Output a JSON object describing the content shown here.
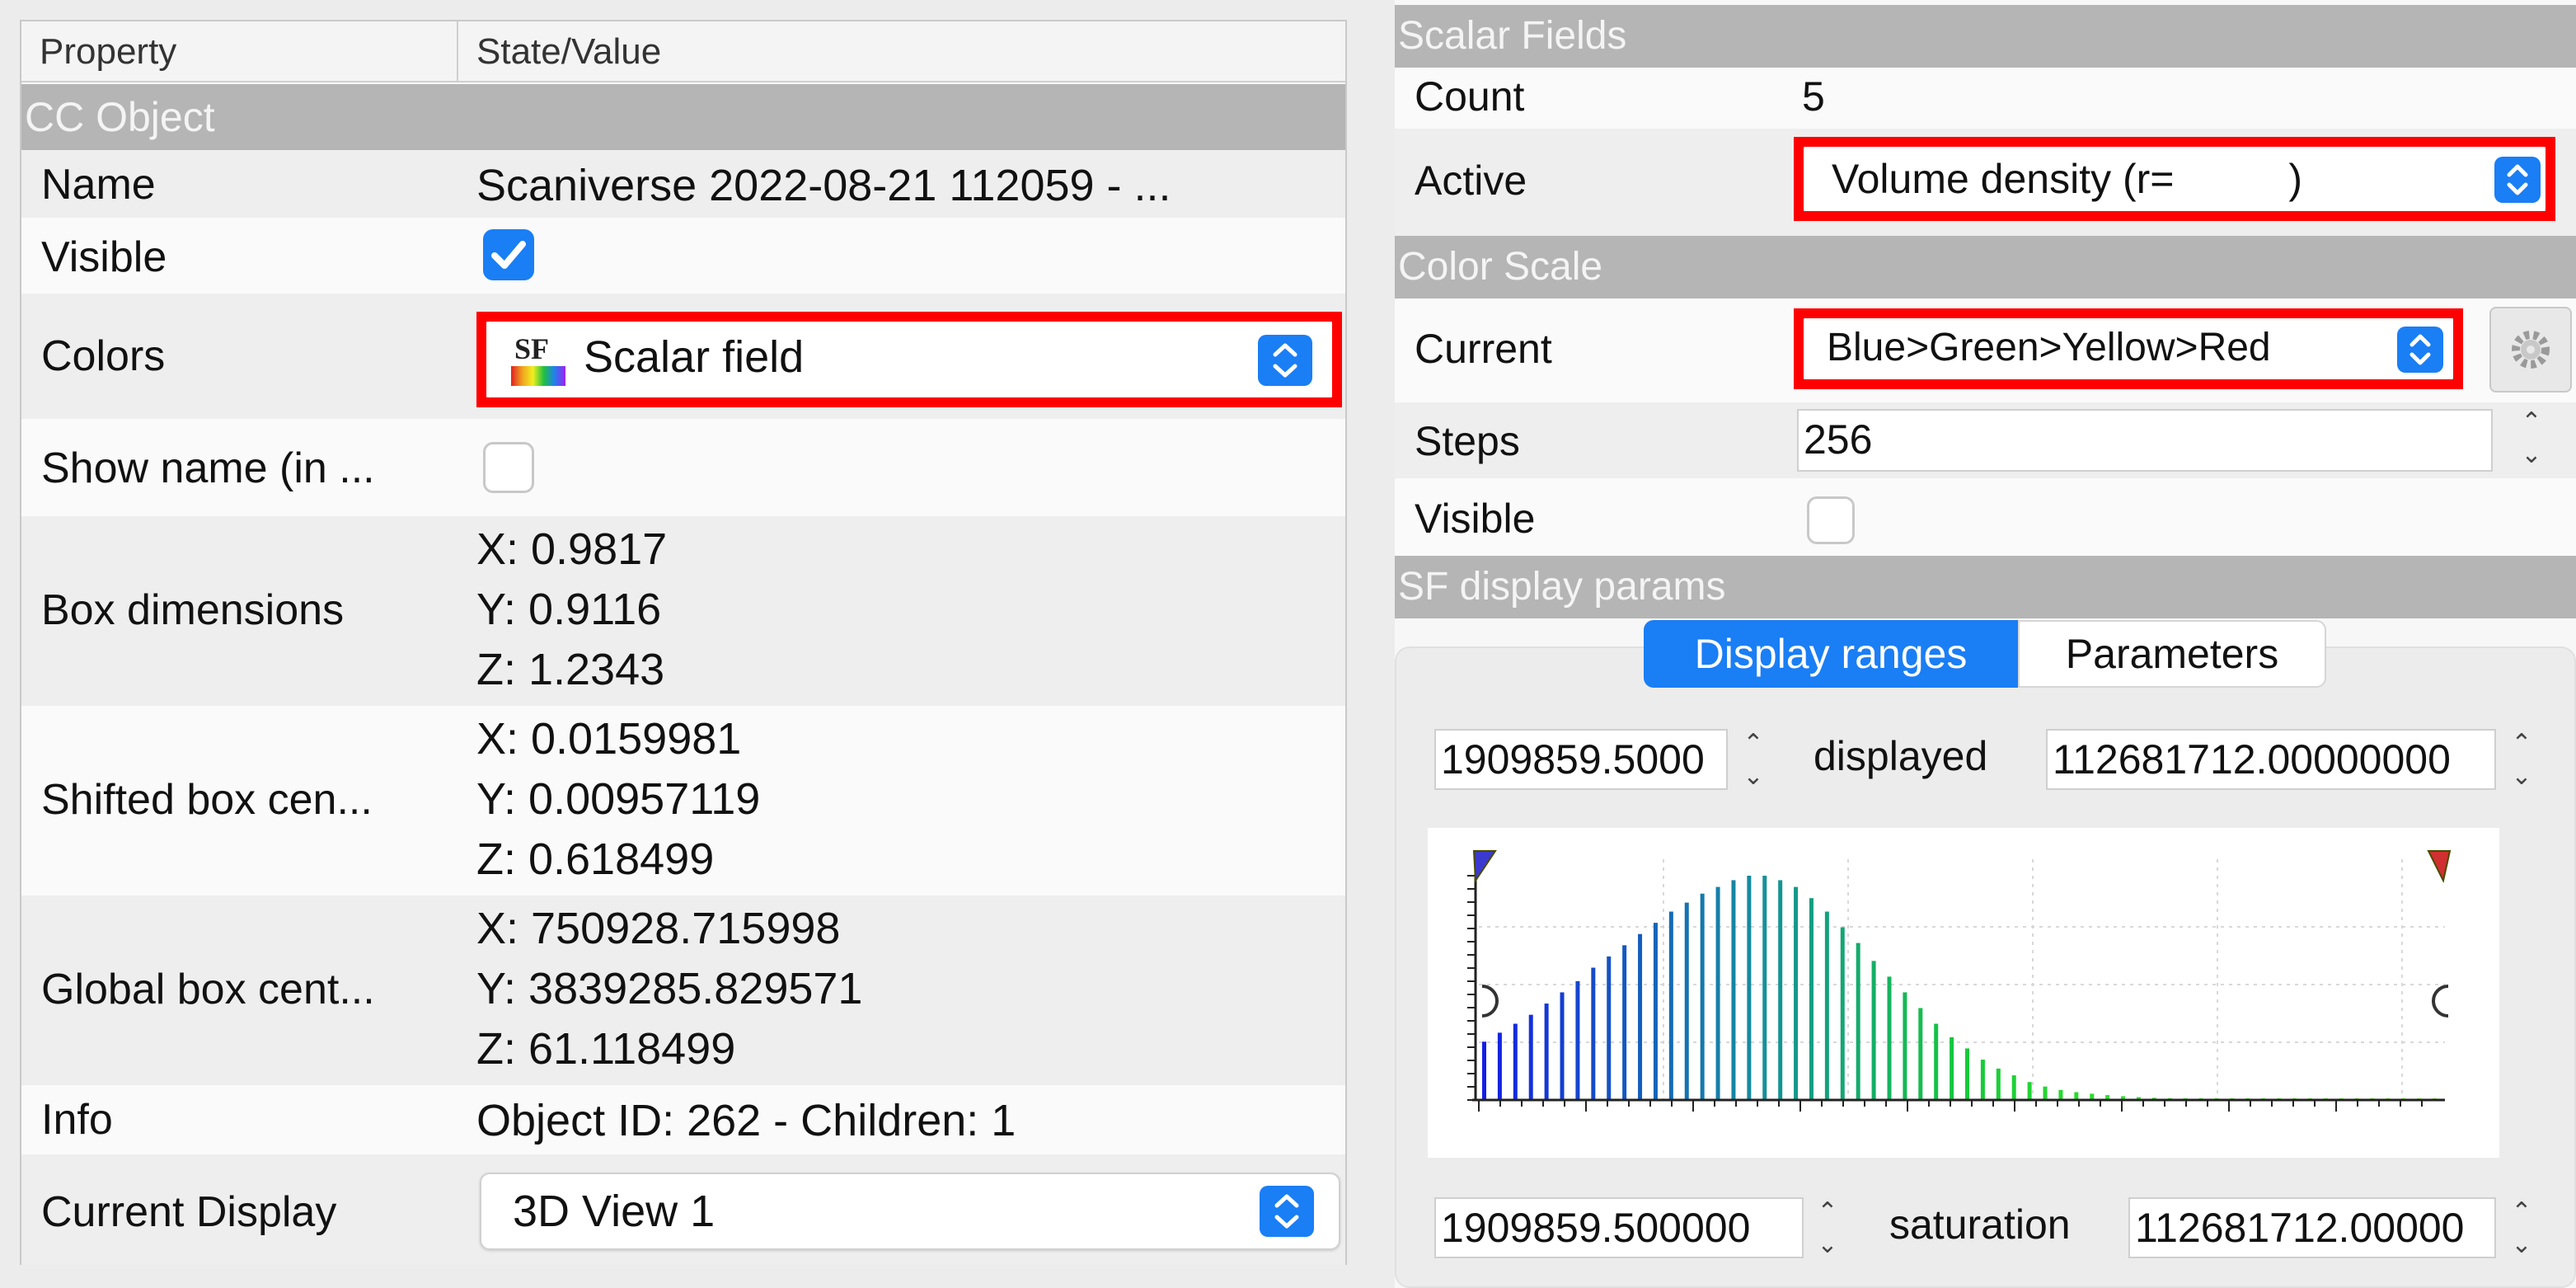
{
  "left": {
    "header": {
      "property": "Property",
      "state_value": "State/Value"
    },
    "section_title": "CC Object",
    "name": {
      "label": "Name",
      "value": "Scaniverse 2022-08-21 112059 - ..."
    },
    "visible": {
      "label": "Visible",
      "checked": true
    },
    "colors": {
      "label": "Colors",
      "icon_text": "SF",
      "value": "Scalar field"
    },
    "show_name": {
      "label": "Show name (in ...",
      "checked": false
    },
    "box_dimensions": {
      "label": "Box dimensions",
      "x": "X: 0.9817",
      "y": "Y: 0.9116",
      "z": "Z: 1.2343"
    },
    "shifted_center": {
      "label": "Shifted box cen...",
      "x": "X: 0.0159981",
      "y": "Y: 0.00957119",
      "z": "Z: 0.618499"
    },
    "global_center": {
      "label": "Global box cent...",
      "x": "X: 750928.715998",
      "y": "Y: 3839285.829571",
      "z": "Z: 61.118499"
    },
    "info": {
      "label": "Info",
      "value": "Object ID: 262 - Children: 1"
    },
    "current_display": {
      "label": "Current Display",
      "value": "3D View 1"
    }
  },
  "right": {
    "scalar_fields": {
      "title": "Scalar Fields",
      "count_label": "Count",
      "count_value": "5",
      "active_label": "Active",
      "active_value": "Volume density (r=          )"
    },
    "color_scale": {
      "title": "Color Scale",
      "current_label": "Current",
      "current_value": "Blue>Green>Yellow>Red",
      "steps_label": "Steps",
      "steps_value": "256",
      "visible_label": "Visible",
      "visible_checked": false
    },
    "sf_display": {
      "title": "SF display params",
      "tab_ranges": "Display ranges",
      "tab_parameters": "Parameters",
      "displayed_min": "1909859.5000",
      "displayed_label": "displayed",
      "displayed_max": "112681712.00000000",
      "saturation_min": "1909859.500000",
      "saturation_label": "saturation",
      "saturation_max": "112681712.00000"
    }
  },
  "colors": {
    "accent": "#1a7ef5",
    "highlight": "#ff0000",
    "section": "#b5b5b5"
  },
  "chart_data": {
    "type": "bar",
    "title": "",
    "xlabel": "",
    "ylabel": "",
    "values": [
      0.26,
      0.3,
      0.34,
      0.38,
      0.43,
      0.48,
      0.53,
      0.59,
      0.64,
      0.69,
      0.74,
      0.79,
      0.84,
      0.88,
      0.92,
      0.95,
      0.98,
      1.0,
      1.0,
      0.98,
      0.95,
      0.9,
      0.84,
      0.77,
      0.7,
      0.62,
      0.55,
      0.48,
      0.41,
      0.34,
      0.28,
      0.23,
      0.18,
      0.14,
      0.11,
      0.08,
      0.06,
      0.045,
      0.035,
      0.028,
      0.022,
      0.017,
      0.013,
      0.01,
      0.008,
      0.006,
      0.005,
      0.004,
      0.003,
      0.0025,
      0.002,
      0.0015,
      0.0012,
      0.001,
      0.0008,
      0.0006,
      0.0005,
      0.0004,
      0.0003,
      0.0002,
      0.0002,
      0.0001
    ],
    "grid": true
  }
}
